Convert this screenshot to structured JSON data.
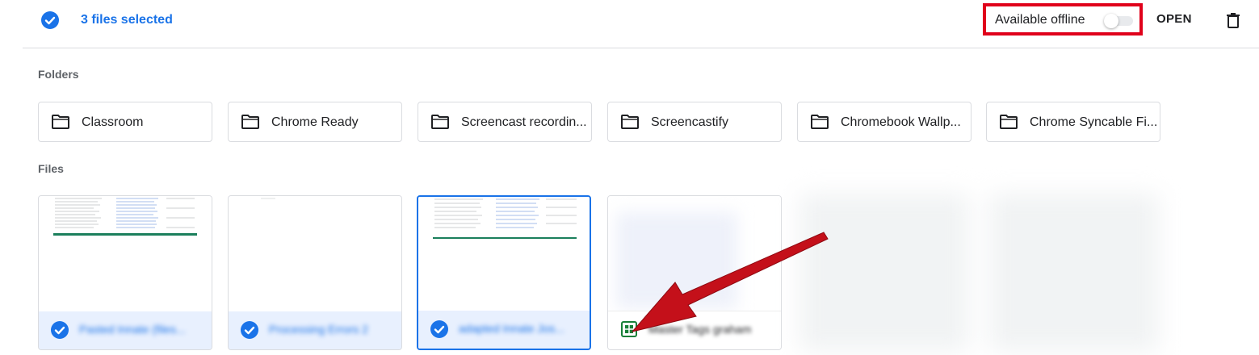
{
  "selection": {
    "count_label": "3 files selected",
    "offline_label": "Available offline",
    "offline_enabled": false,
    "open_label": "OPEN"
  },
  "sections": {
    "folders_title": "Folders",
    "files_title": "Files"
  },
  "folders": [
    {
      "name": "Classroom"
    },
    {
      "name": "Chrome Ready"
    },
    {
      "name": "Screencast recordin..."
    },
    {
      "name": "Screencastify"
    },
    {
      "name": "Chromebook Wallp..."
    },
    {
      "name": "Chrome Syncable Fi..."
    }
  ],
  "files": [
    {
      "name": "Pasted Innate (files...",
      "selected": true
    },
    {
      "name": "Processing Errors 2",
      "selected": true
    },
    {
      "name": "adapted Innate Jos...",
      "selected": true
    },
    {
      "name": "Master Tags graham",
      "selected": false
    }
  ],
  "colors": {
    "accent": "#1a73e8",
    "highlight_box": "#e0001b",
    "arrow": "#c4101a",
    "sheet_green": "#188038"
  },
  "icons": {
    "selection": "check-circle-icon",
    "delete": "trash-icon",
    "folder": "folder-icon",
    "sheet": "google-sheets-icon"
  }
}
